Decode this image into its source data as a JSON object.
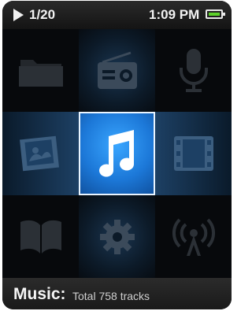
{
  "status": {
    "track_counter": "1/20",
    "time": "1:09 PM",
    "battery_color": "#5dd12a"
  },
  "menu": {
    "items": [
      {
        "name": "folder",
        "icon": "folder-icon",
        "state": "dim"
      },
      {
        "name": "radio",
        "icon": "radio-icon",
        "state": "dim"
      },
      {
        "name": "recording",
        "icon": "microphone-icon",
        "state": "dim"
      },
      {
        "name": "pictures",
        "icon": "picture-icon",
        "state": "adjacent"
      },
      {
        "name": "music",
        "icon": "music-note-icon",
        "state": "selected"
      },
      {
        "name": "video",
        "icon": "film-icon",
        "state": "adjacent"
      },
      {
        "name": "audiobooks",
        "icon": "book-icon",
        "state": "dim"
      },
      {
        "name": "settings",
        "icon": "gear-icon",
        "state": "dim"
      },
      {
        "name": "broadcast",
        "icon": "antenna-icon",
        "state": "dim"
      }
    ],
    "selected_color": "#1c78d8"
  },
  "footer": {
    "label": "Music:",
    "detail": "Total 758 tracks"
  }
}
